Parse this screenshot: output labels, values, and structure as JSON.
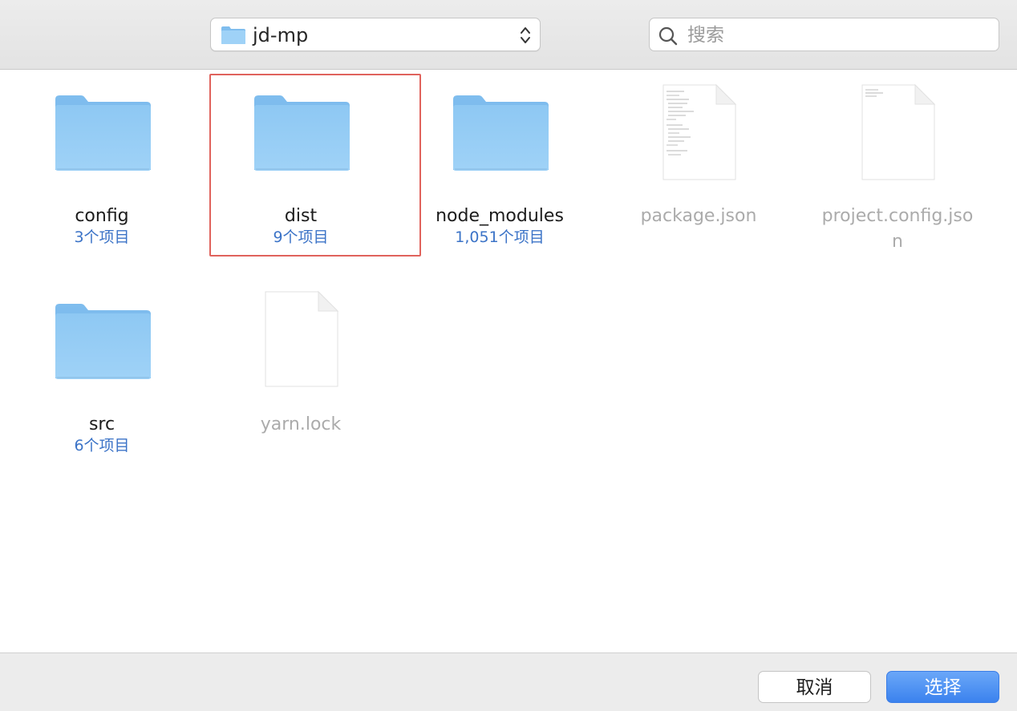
{
  "toolbar": {
    "path_label": "jd-mp",
    "search_placeholder": "搜索"
  },
  "items": [
    {
      "name": "config",
      "count": "3个项目",
      "kind": "folder"
    },
    {
      "name": "dist",
      "count": "9个项目",
      "kind": "folder",
      "selected": true
    },
    {
      "name": "node_modules",
      "count": "1,051个项目",
      "kind": "folder"
    },
    {
      "name": "package.json",
      "kind": "document"
    },
    {
      "name_line1": "project.config.jso",
      "name_line2": "n",
      "kind": "document"
    },
    {
      "name": "src",
      "count": "6个项目",
      "kind": "folder"
    },
    {
      "name": "yarn.lock",
      "kind": "document"
    }
  ],
  "footer": {
    "cancel_label": "取消",
    "choose_label": "选择"
  },
  "colors": {
    "accent": "#3b82ee",
    "selection_border": "#e0625c",
    "item_count": "#3b73c7",
    "folder": "#8ec8f3"
  }
}
